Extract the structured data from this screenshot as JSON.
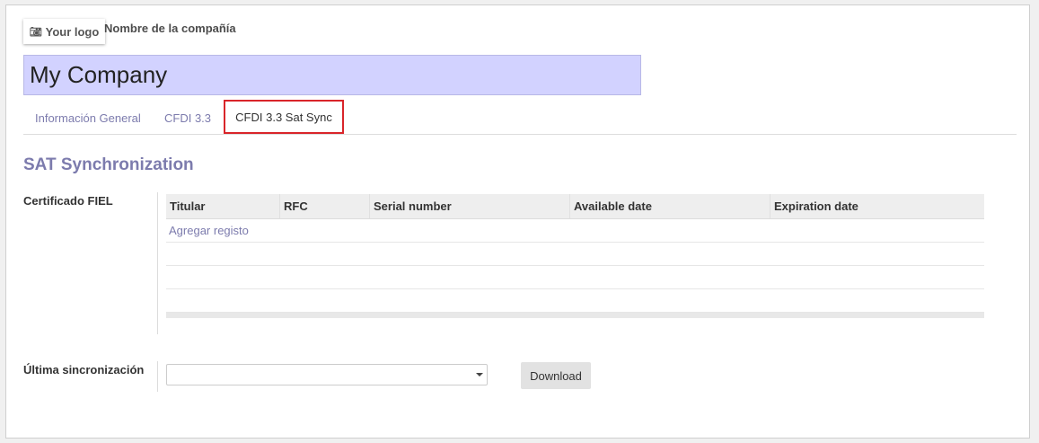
{
  "header": {
    "logo_text": "Your logo",
    "company_label": "Nombre de la compañía",
    "company_name": "My Company"
  },
  "tabs": [
    {
      "label": "Información General",
      "active": false
    },
    {
      "label": "CFDI 3.3",
      "active": false
    },
    {
      "label": "CFDI 3.3 Sat Sync",
      "active": true
    }
  ],
  "section": {
    "title": "SAT Synchronization"
  },
  "fiel": {
    "label": "Certificado FIEL",
    "columns": [
      "Titular",
      "RFC",
      "Serial number",
      "Available date",
      "Expiration date"
    ],
    "add_link": "Agregar registo"
  },
  "sync": {
    "label": "Última sincronización",
    "select_value": "",
    "download_label": "Download"
  },
  "colors": {
    "accent": "#7c7bad",
    "highlight_border": "#d9252a",
    "company_field_bg": "#d2d2ff"
  },
  "icons": {
    "logo": "camera-icon",
    "select": "caret-down-icon"
  }
}
